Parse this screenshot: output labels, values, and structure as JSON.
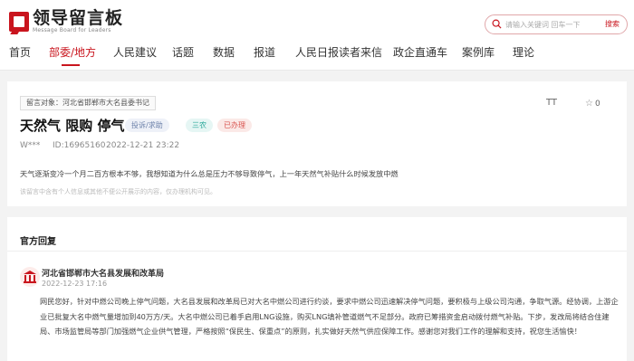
{
  "header": {
    "logo_cn": "领导留言板",
    "logo_en": "Message Board for Leaders",
    "search_placeholder": "请输入关键词 回车一下",
    "search_button": "搜索"
  },
  "nav": {
    "items": [
      "首页",
      "部委/地方",
      "人民建议",
      "话题",
      "数据",
      "报道",
      "人民日报读者来信",
      "政企直通车",
      "案例库",
      "理论"
    ],
    "active_index": 1
  },
  "message": {
    "target": "留言对象：河北省邯郸市大名县委书记",
    "title": "天然气 限购 停气",
    "tags": [
      "投诉/求助",
      "三农",
      "已办理"
    ],
    "user": "W***",
    "id": "ID:16965160",
    "datetime": "2022-12-21 23:22",
    "content": "天气逐渐变冷一个月二百方根本不够，我想知道为什么总是压力不够导致停气，上一年天然气补贴什么时候发放中燃",
    "note": "该留言中含有个人信息或其他不便公开展示的内容，仅办理机构可见。",
    "font_button": "TT",
    "favorite_count": "0"
  },
  "reply": {
    "heading": "官方回复",
    "org": "河北省邯郸市大名县发展和改革局",
    "datetime": "2022-12-23 17:16",
    "text": "网民您好，针对中燃公司晚上停气问题，大名县发展和改革局已对大名中燃公司进行约谈，要求中燃公司迅速解决停气问题，要积极与上级公司沟通，争取气源。经协调，上游企业已批复大名中燃气量增加到40万方/天。大名中燃公司已着手启用LNG设施，购买LNG填补管道燃气不足部分。政府已筹措资金启动拨付燃气补贴。下步，发改局将结合住建局、市场监管局等部门加强燃气企业供气管理，严格按照“保民生、保重点”的原则，扎实做好天然气供应保障工作。感谢您对我们工作的理解和支持，祝您生活愉快！"
  },
  "colors": {
    "brand": "#c9151e",
    "tag_blue": "#6a7fa8",
    "tag_teal": "#2aa89a",
    "tag_red": "#d9544f"
  },
  "icons": [
    "search-icon",
    "font-size-icon",
    "star-icon",
    "building-icon"
  ]
}
